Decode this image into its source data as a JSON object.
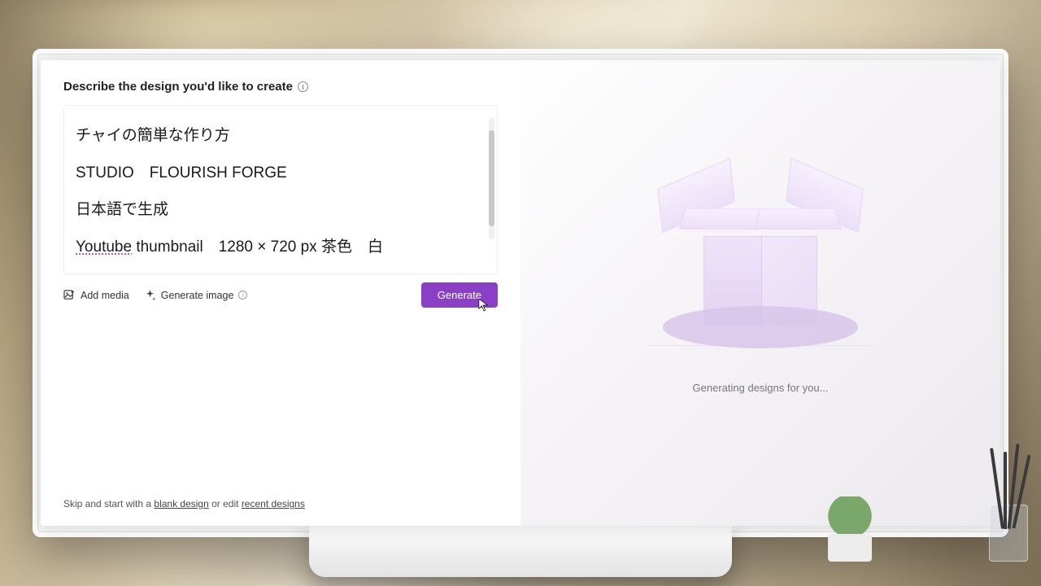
{
  "header": {
    "title": "Describe the design you'd like to create"
  },
  "prompt": {
    "line1": "チャイの簡単な作り方",
    "line2": "STUDIO　FLOURISH FORGE",
    "line3": "日本語で生成",
    "line4_underlined": "Youtube",
    "line4_rest": " thumbnail　1280 × 720 px 茶色　白"
  },
  "toolbar": {
    "add_media": "Add media",
    "generate_image": "Generate image",
    "generate_button": "Generate"
  },
  "skip": {
    "prefix": "Skip and start with a ",
    "blank_link": "blank design",
    "middle": " or edit ",
    "recent_link": "recent designs"
  },
  "right": {
    "status": "Generating designs for you..."
  },
  "colors": {
    "accent": "#8b3fc7"
  }
}
